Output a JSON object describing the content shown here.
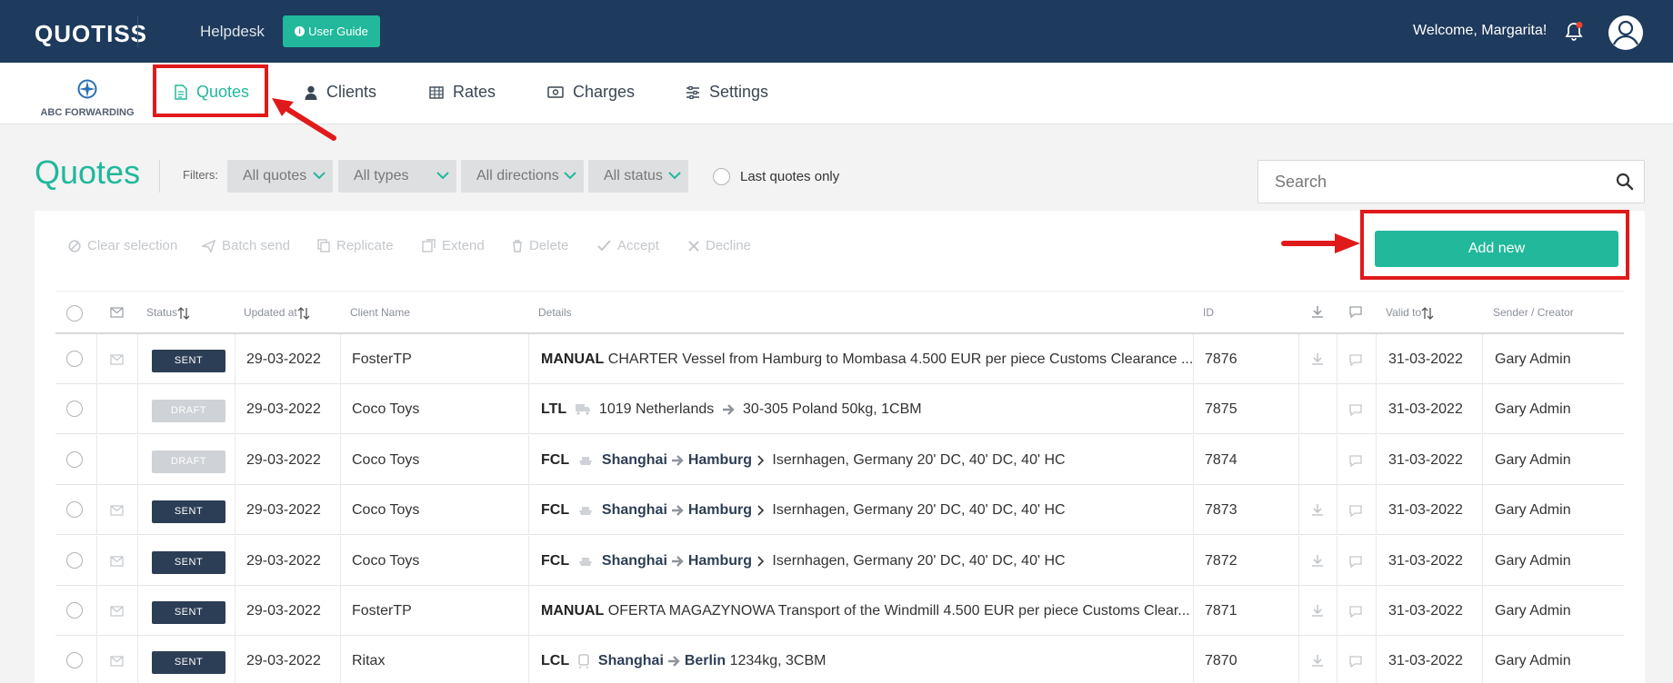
{
  "header": {
    "logo": "QUOTISS",
    "helpdesk": "Helpdesk",
    "user_guide": "User Guide",
    "welcome": "Welcome, Margarita!",
    "notification_dot_color": "#e8442e"
  },
  "brand": {
    "name": "ABC FORWARDING"
  },
  "nav": {
    "quotes": "Quotes",
    "clients": "Clients",
    "rates": "Rates",
    "charges": "Charges",
    "settings": "Settings"
  },
  "page": {
    "title": "Quotes",
    "filters_label": "Filters:",
    "filters": [
      "All quotes",
      "All types",
      "All directions",
      "All status"
    ],
    "last_quotes_only": "Last quotes only",
    "search_placeholder": "Search"
  },
  "toolbar": {
    "clear_selection": "Clear selection",
    "batch_send": "Batch send",
    "replicate": "Replicate",
    "extend": "Extend",
    "delete": "Delete",
    "accept": "Accept",
    "decline": "Decline",
    "add_new": "Add new"
  },
  "table": {
    "headers": {
      "status": "Status",
      "updated_at": "Updated at",
      "client_name": "Client Name",
      "details": "Details",
      "id": "ID",
      "valid_to": "Valid to",
      "sender": "Sender / Creator"
    },
    "rows": [
      {
        "status": "SENT",
        "updated": "29-03-2022",
        "client": "FosterTP",
        "mode": "MANUAL",
        "detail_text": "CHARTER Vessel from Hamburg to Mombasa 4.500 EUR per piece Customs Clearance ...",
        "id": "7876",
        "valid_to": "31-03-2022",
        "sender": "Gary Admin"
      },
      {
        "status": "DRAFT",
        "updated": "29-03-2022",
        "client": "Coco Toys",
        "mode": "LTL",
        "detail_text": "1019 Netherlands",
        "detail_to": "30-305 Poland  50kg, 1CBM",
        "id": "7875",
        "valid_to": "31-03-2022",
        "sender": "Gary Admin"
      },
      {
        "status": "DRAFT",
        "updated": "29-03-2022",
        "client": "Coco Toys",
        "mode": "FCL",
        "from": "Shanghai",
        "to": "Hamburg",
        "detail_text": "Isernhagen, Germany 20' DC, 40' DC, 40' HC",
        "id": "7874",
        "valid_to": "31-03-2022",
        "sender": "Gary Admin"
      },
      {
        "status": "SENT",
        "updated": "29-03-2022",
        "client": "Coco Toys",
        "mode": "FCL",
        "from": "Shanghai",
        "to": "Hamburg",
        "detail_text": "Isernhagen, Germany 20' DC, 40' DC, 40' HC",
        "id": "7873",
        "valid_to": "31-03-2022",
        "sender": "Gary Admin"
      },
      {
        "status": "SENT",
        "updated": "29-03-2022",
        "client": "Coco Toys",
        "mode": "FCL",
        "from": "Shanghai",
        "to": "Hamburg",
        "detail_text": "Isernhagen, Germany 20' DC, 40' DC, 40' HC",
        "id": "7872",
        "valid_to": "31-03-2022",
        "sender": "Gary Admin"
      },
      {
        "status": "SENT",
        "updated": "29-03-2022",
        "client": "FosterTP",
        "mode": "MANUAL",
        "detail_text": "OFERTA MAGAZYNOWA Transport of the Windmill 4.500 EUR per piece Customs Clear...",
        "id": "7871",
        "valid_to": "31-03-2022",
        "sender": "Gary Admin"
      },
      {
        "status": "SENT",
        "updated": "29-03-2022",
        "client": "Ritax",
        "mode": "LCL",
        "from": "Shanghai",
        "to": "Berlin",
        "detail_text": "1234kg, 3CBM",
        "id": "7870",
        "valid_to": "31-03-2022",
        "sender": "Gary Admin"
      }
    ]
  },
  "colors": {
    "topbar": "#1e3a5c",
    "accent": "#21b89b",
    "sent_badge": "#2c3e55",
    "draft_badge": "#cfd2d6",
    "highlight": "#e01a1a"
  }
}
